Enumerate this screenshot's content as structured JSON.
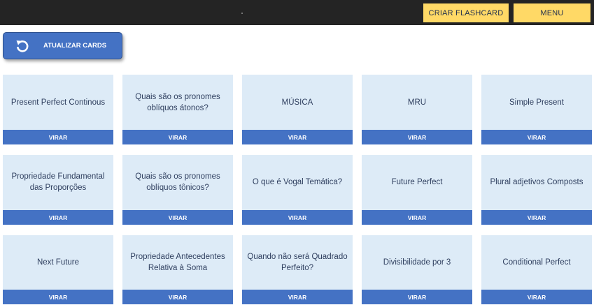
{
  "header": {
    "create_label": "CRIAR FLASHCARD",
    "menu_label": "MENU"
  },
  "refresh": {
    "label": "ATUALIZAR CARDS",
    "icon": "refresh-icon"
  },
  "flip_label": "VIRAR",
  "cards": [
    "Present Perfect Continous",
    "Quais são os pronomes oblíquos átonos?",
    "MÚSICA",
    "MRU",
    "Simple Present",
    "Propriedade Fundamental das Proporções",
    "Quais são os pronomes oblíquos tônicos?",
    "O que é Vogal Temática?",
    "Future Perfect",
    "Plural adjetivos Composts",
    "Next Future",
    "Propriedade Antecedentes Relativa à Soma",
    "Quando não será Quadrado Perfeito?",
    "Divisibilidade por 3",
    "Conditional Perfect"
  ],
  "colors": {
    "topbar": "#242424",
    "header_button": "#ffd966",
    "card_bg": "#ddebf7",
    "accent_blue": "#4472c4"
  }
}
